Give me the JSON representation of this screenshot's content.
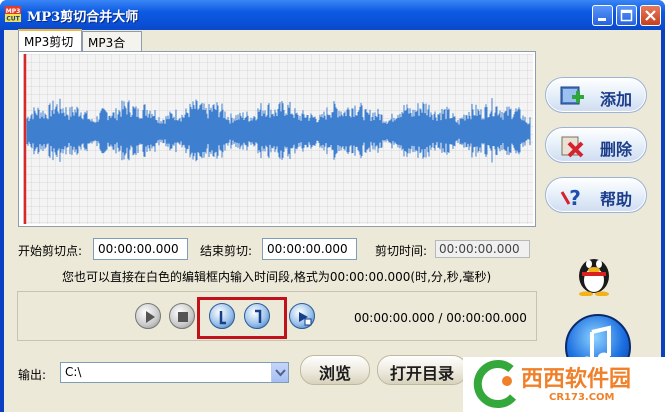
{
  "window": {
    "title": "MP3剪切合并大师",
    "app_icon_text": "MP3 CUT"
  },
  "tabs": [
    {
      "label": "MP3剪切",
      "active": true
    },
    {
      "label": "MP3合并",
      "active": false
    }
  ],
  "side_buttons": [
    {
      "label": "添加",
      "icon": "add-music-icon"
    },
    {
      "label": "删除",
      "icon": "delete-icon"
    },
    {
      "label": "帮助",
      "icon": "help-icon"
    }
  ],
  "cut": {
    "start_label": "开始剪切点:",
    "start_value": "00:00:00.000",
    "end_label": "结束剪切:",
    "end_value": "00:00:00.000",
    "duration_label": "剪切时间:",
    "duration_value": "00:00:00.000",
    "hint": "您也可以直接在白色的编辑框内输入时间段,格式为00:00:00.000(时,分,秒,毫秒)"
  },
  "player": {
    "time": "00:00:00.000 / 00:00:00.000",
    "buttons": [
      "play-icon",
      "stop-icon",
      "mark-start-icon",
      "mark-end-icon",
      "cut-play-icon"
    ]
  },
  "output": {
    "label": "输出:",
    "path": "C:\\",
    "browse_label": "浏览",
    "open_dir_label": "打开目录"
  },
  "watermark": {
    "name": "西西软件园",
    "url": "CR173.COM"
  },
  "colors": {
    "title_bar": "#0a4fd6",
    "highlight_box": "#c1121c",
    "waveform": "#3f7fd0",
    "playhead": "#d42a2a"
  }
}
